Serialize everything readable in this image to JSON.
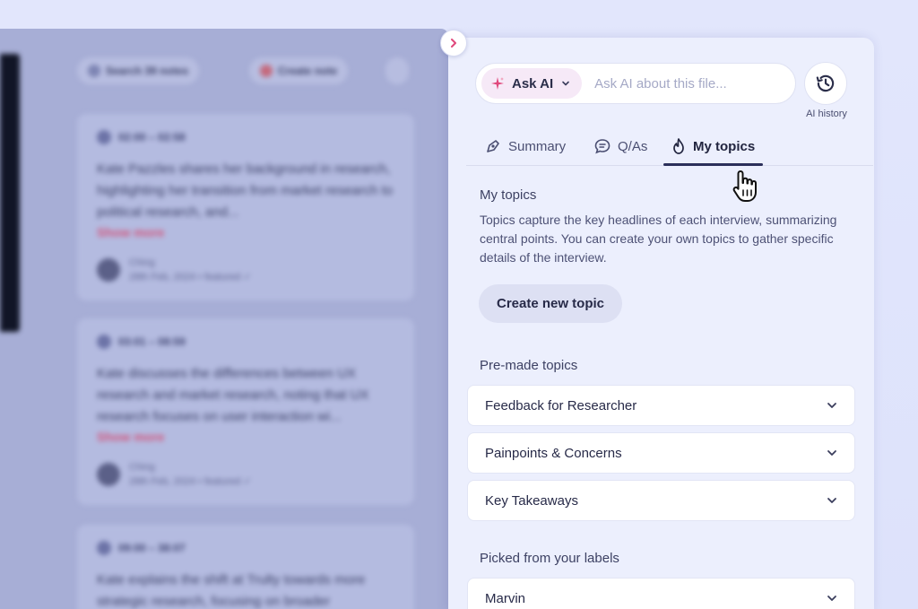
{
  "left_panel": {
    "toolbar": {
      "search_label": "Search 39 notes",
      "create_label": "Create note"
    },
    "notes": [
      {
        "time": "02:00 – 02:58",
        "text": "Kate Pazzles shares her background in research, highlighting her transition from market research to political research, and...",
        "more": "Show more",
        "author": "Ching",
        "meta": "28th Feb, 2024 • featured ✓"
      },
      {
        "time": "03:01 – 08:59",
        "text": "Kate discusses the differences between UX research and market research, noting that UX research focuses on user interaction wi...",
        "more": "Show more",
        "author": "Ching",
        "meta": "28th Feb, 2024 • featured ✓"
      },
      {
        "time": "09:00 – 38:07",
        "text": "Kate explains the shift at Trulty towards more strategic research, focusing on broader",
        "more": "",
        "author": "",
        "meta": ""
      }
    ]
  },
  "ask": {
    "pill_label": "Ask AI",
    "placeholder": "Ask AI about this file...",
    "history_label": "AI history"
  },
  "tabs": [
    {
      "label": "Summary",
      "icon": "summary-icon"
    },
    {
      "label": "Q/As",
      "icon": "chat-icon"
    },
    {
      "label": "My topics",
      "icon": "flame-icon",
      "active": true
    }
  ],
  "my_topics": {
    "title": "My topics",
    "description": "Topics capture the key headlines of each interview, summarizing central points. You can create your own topics to gather specific details of the interview.",
    "create_button": "Create new topic"
  },
  "premade": {
    "title": "Pre-made topics",
    "items": [
      "Feedback for Researcher",
      "Painpoints & Concerns",
      "Key Takeaways"
    ]
  },
  "labels_section": {
    "title": "Picked from your labels",
    "items": [
      "Marvin"
    ]
  },
  "colors": {
    "accent_pink": "#e0487c",
    "text_dark": "#272a48",
    "panel_bg": "#eceffd"
  }
}
